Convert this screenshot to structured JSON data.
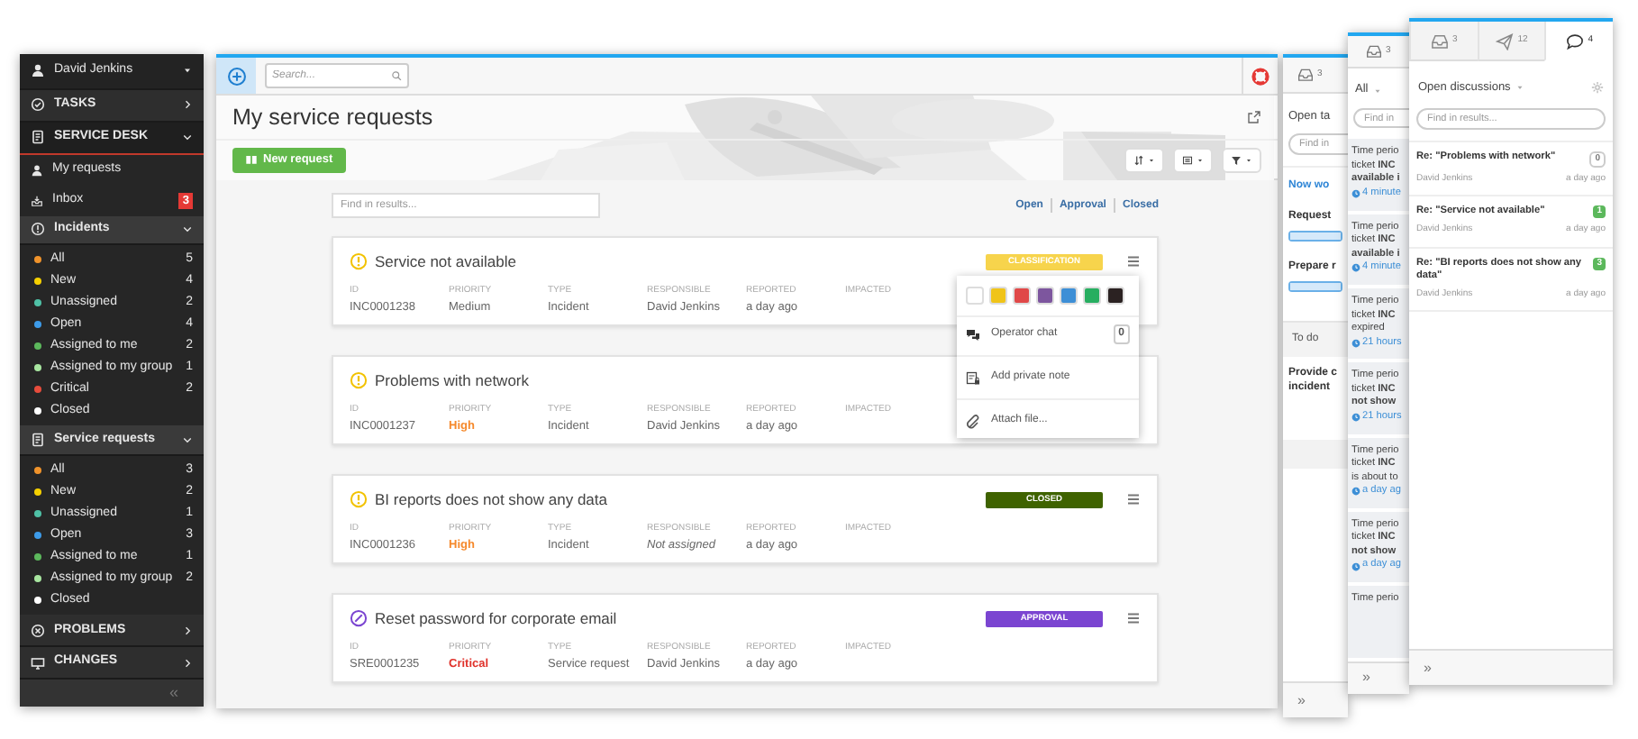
{
  "sidebar": {
    "user": "David Jenkins",
    "items": [
      {
        "kind": "module",
        "label": "TASKS",
        "expanded": false
      },
      {
        "kind": "module",
        "label": "SERVICE DESK",
        "expanded": true,
        "children": [
          {
            "kind": "link",
            "label": "My requests"
          },
          {
            "kind": "link",
            "label": "Inbox",
            "badge": "3"
          },
          {
            "kind": "group",
            "label": "Incidents",
            "expanded": true,
            "children": [
              {
                "label": "All",
                "count": "5",
                "color": "#f0932b"
              },
              {
                "label": "New",
                "count": "4",
                "color": "#f5d000"
              },
              {
                "label": "Unassigned",
                "count": "2",
                "color": "#4fc1a6"
              },
              {
                "label": "Open",
                "count": "4",
                "color": "#3d9be9"
              },
              {
                "label": "Assigned to me",
                "count": "2",
                "color": "#5cb85c"
              },
              {
                "label": "Assigned to my group",
                "count": "1",
                "color": "#a8e6a0"
              },
              {
                "label": "Critical",
                "count": "2",
                "color": "#e74c3c"
              },
              {
                "label": "Closed",
                "color": "#ffffff"
              }
            ]
          },
          {
            "kind": "group",
            "label": "Service requests",
            "expanded": true,
            "children": [
              {
                "label": "All",
                "count": "3",
                "color": "#f0932b"
              },
              {
                "label": "New",
                "count": "2",
                "color": "#f5d000"
              },
              {
                "label": "Unassigned",
                "count": "1",
                "color": "#4fc1a6"
              },
              {
                "label": "Open",
                "count": "3",
                "color": "#3d9be9"
              },
              {
                "label": "Assigned to me",
                "count": "1",
                "color": "#5cb85c"
              },
              {
                "label": "Assigned to my group",
                "count": "2",
                "color": "#a8e6a0"
              },
              {
                "label": "Closed",
                "color": "#ffffff"
              }
            ]
          }
        ]
      },
      {
        "kind": "module",
        "label": "PROBLEMS",
        "expanded": false
      },
      {
        "kind": "module",
        "label": "CHANGES",
        "expanded": false
      }
    ],
    "collapse": "«"
  },
  "main": {
    "search": {
      "placeholder": "Search..."
    },
    "title": "My service requests",
    "new_button": "New request",
    "filter": {
      "placeholder": "Find in results..."
    },
    "views": [
      {
        "label": "Open"
      },
      {
        "label": "Approval"
      },
      {
        "label": "Closed"
      }
    ],
    "tickets": [
      {
        "kind": "incident",
        "title": "Service not available",
        "menu_button": true,
        "menu_open": true,
        "status": {
          "label": "CLASSIFICATION",
          "color": "#f7d44c"
        },
        "fields": [
          {
            "label": "ID",
            "value": "INC0001238"
          },
          {
            "label": "PRIORITY",
            "value": "Medium",
            "color": "#666666"
          },
          {
            "label": "TYPE",
            "value": "Incident"
          },
          {
            "label": "RESPONSIBLE",
            "value": "David Jenkins"
          },
          {
            "label": "REPORTED",
            "value": "a day ago"
          },
          {
            "label": "IMPACTED"
          }
        ]
      },
      {
        "kind": "incident",
        "title": "Problems with network",
        "menu_button": false,
        "menu_open": false,
        "fields": [
          {
            "label": "ID",
            "value": "INC0001237"
          },
          {
            "label": "PRIORITY",
            "value": "High",
            "color": "#f5892c"
          },
          {
            "label": "TYPE",
            "value": "Incident"
          },
          {
            "label": "RESPONSIBLE",
            "value": "David Jenkins"
          },
          {
            "label": "REPORTED",
            "value": "a day ago"
          },
          {
            "label": "IMPACTED"
          }
        ]
      },
      {
        "kind": "incident",
        "title": "BI reports does not show any data",
        "menu_button": true,
        "menu_open": false,
        "status": {
          "label": "CLOSED",
          "color": "#3f6300"
        },
        "fields": [
          {
            "label": "ID",
            "value": "INC0001236"
          },
          {
            "label": "PRIORITY",
            "value": "High",
            "color": "#f5892c"
          },
          {
            "label": "TYPE",
            "value": "Incident"
          },
          {
            "label": "RESPONSIBLE",
            "value": "Not assigned",
            "empty": true
          },
          {
            "label": "REPORTED",
            "value": "a day ago"
          },
          {
            "label": "IMPACTED"
          }
        ]
      },
      {
        "kind": "request",
        "title": "Reset password for corporate email",
        "menu_button": true,
        "menu_open": false,
        "status": {
          "label": "APPROVAL",
          "color": "#7b45d1"
        },
        "fields": [
          {
            "label": "ID",
            "value": "SRE0001235"
          },
          {
            "label": "PRIORITY",
            "value": "Critical",
            "color": "#e0322b"
          },
          {
            "label": "TYPE",
            "value": "Service request"
          },
          {
            "label": "RESPONSIBLE",
            "value": "David Jenkins"
          },
          {
            "label": "REPORTED",
            "value": "a day ago"
          },
          {
            "label": "IMPACTED"
          }
        ]
      }
    ],
    "menu": {
      "colors": [
        {
          "color": "#ffffff"
        },
        {
          "color": "#f0c419"
        },
        {
          "color": "#e04848"
        },
        {
          "color": "#7d569e"
        },
        {
          "color": "#3d8fd6"
        },
        {
          "color": "#27ae60"
        },
        {
          "color": "#2b2222"
        }
      ],
      "items": [
        {
          "kind": "chat",
          "label": "Operator chat",
          "count": "0"
        },
        {
          "kind": "note",
          "label": "Add private note"
        },
        {
          "kind": "attach",
          "label": "Attach file..."
        }
      ]
    }
  },
  "tasks_panel": {
    "tab_count": "3",
    "heading": "Open ta",
    "search": {
      "placeholder": "Find in"
    },
    "group": "Now wo",
    "tasks": [
      {
        "title": "Request",
        "level": 1
      },
      {
        "title": "Prepare r",
        "level": 1
      }
    ],
    "todo_label": "To do",
    "todo_lines": [
      "Provide c",
      "incident"
    ],
    "footer": "»"
  },
  "notifications_panel": {
    "tab_count": "3",
    "filter": "All",
    "search": {
      "placeholder": "Find in"
    },
    "items": [
      {
        "lines": [
          "Time perio",
          "ticket **INC**",
          "**available i**"
        ],
        "time": "4 minute"
      },
      {
        "lines": [
          "Time perio",
          "ticket **INC**",
          "**available i**"
        ],
        "time": "4 minute"
      },
      {
        "lines": [
          "Time perio",
          "ticket **INC**",
          "expired"
        ],
        "time": "21 hours"
      },
      {
        "lines": [
          "Time perio",
          "ticket **INC**",
          "**not show**"
        ],
        "time": "21 hours"
      },
      {
        "lines": [
          "Time perio",
          "ticket **INC**",
          "is about to"
        ],
        "time": "a day ag"
      },
      {
        "lines": [
          "Time perio",
          "ticket **INC**",
          "**not show**"
        ],
        "time": "a day ag"
      },
      {
        "lines": [
          "Time perio"
        ]
      }
    ],
    "footer": "»"
  },
  "discussions_panel": {
    "tabs": [
      {
        "kind": "inbox",
        "count": "3",
        "selected": false
      },
      {
        "kind": "send",
        "count": "12",
        "selected": false
      },
      {
        "kind": "chat",
        "count": "4",
        "selected": true
      }
    ],
    "heading": "Open discussions",
    "search": {
      "placeholder": "Find in results..."
    },
    "items": [
      {
        "title": "Re: \"Problems with network\"",
        "count": "0",
        "new": false,
        "author": "David Jenkins",
        "time": "a day ago"
      },
      {
        "title": "Re: \"Service not available\"",
        "count": "1",
        "new": true,
        "author": "David Jenkins",
        "time": "a day ago"
      },
      {
        "title": "Re: \"BI reports does not show any data\"",
        "count": "3",
        "new": true,
        "author": "David Jenkins",
        "time": "a day ago"
      }
    ],
    "footer": "»"
  }
}
